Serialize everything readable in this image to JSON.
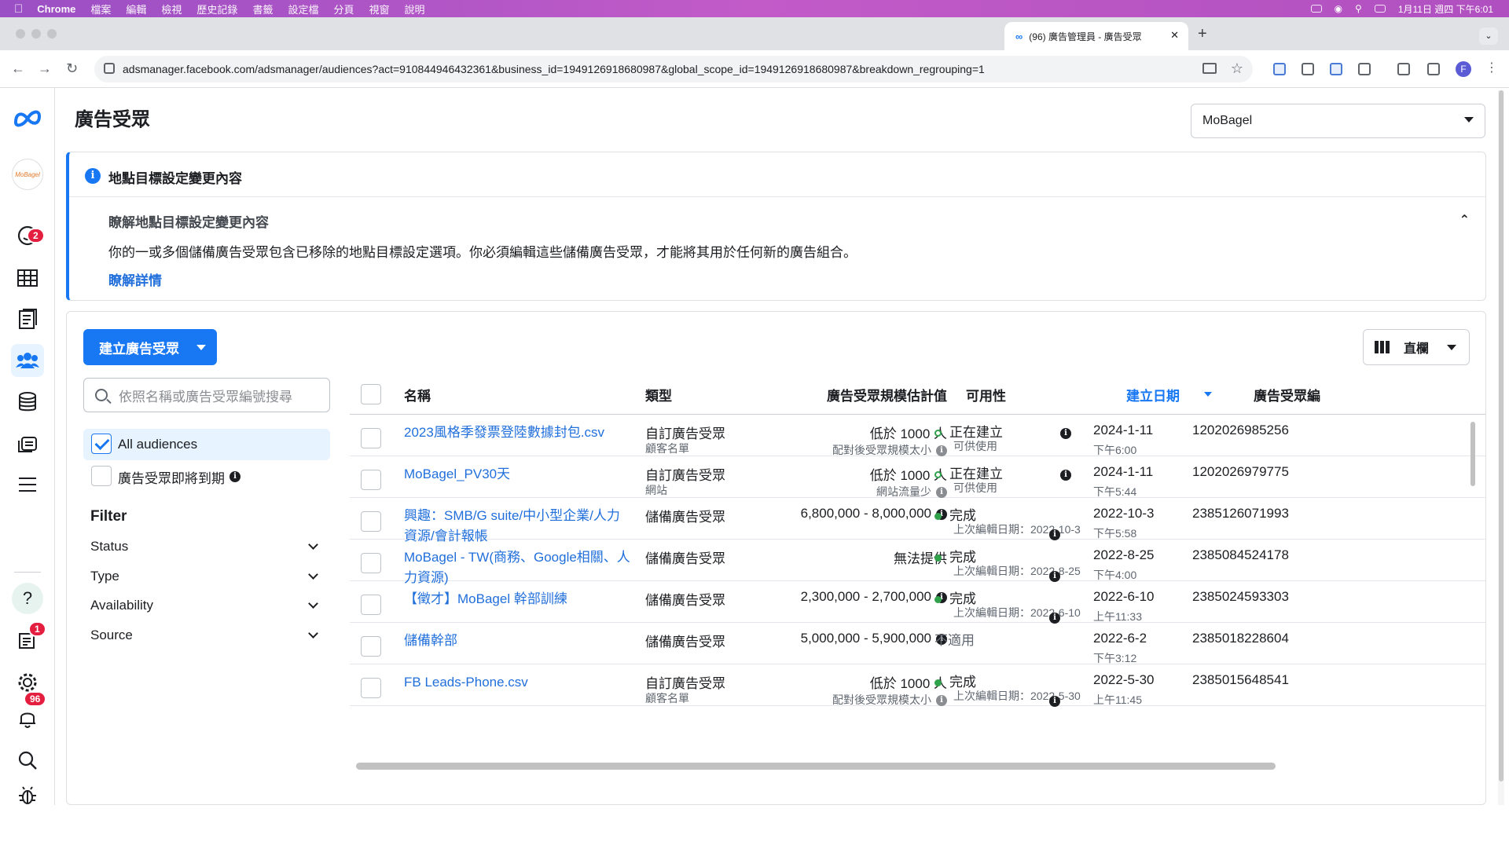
{
  "menubar": {
    "app": "Chrome",
    "items": [
      "檔案",
      "編輯",
      "檢視",
      "歷史記錄",
      "書籤",
      "設定檔",
      "分頁",
      "視窗",
      "說明"
    ],
    "clock": "1月11日 週四 下午6:01"
  },
  "browser": {
    "tab_title": "(96) 廣告管理員 - 廣告受眾",
    "new_tab": "+",
    "url": "adsmanager.facebook.com/adsmanager/audiences?act=910844946432361&business_id=1949126918680987&global_scope_id=1949126918680987&breakdown_regrouping=1",
    "profile": "F"
  },
  "rail": {
    "notifications_badge": "2",
    "alerts_badge": "1",
    "bell_badge": "96",
    "account_logo": "MoBagel"
  },
  "header": {
    "title": "廣告受眾",
    "account": "MoBagel"
  },
  "notice": {
    "title": "地點目標設定變更內容",
    "subtitle": "瞭解地點目標設定變更內容",
    "body": "你的一或多個儲備廣告受眾包含已移除的地點目標設定選項。你必須編輯這些儲備廣告受眾，才能將其用於任何新的廣告組合。",
    "link": "瞭解詳情"
  },
  "toolbar": {
    "create_label": "建立廣告受眾",
    "columns_label": "直欄",
    "search_placeholder": "依照名稱或廣告受眾編號搜尋"
  },
  "filters": {
    "all": "All audiences",
    "expiring": "廣告受眾即將到期",
    "heading": "Filter",
    "items": [
      "Status",
      "Type",
      "Availability",
      "Source"
    ]
  },
  "table": {
    "columns": [
      "名稱",
      "類型",
      "廣告受眾規模估計值",
      "可用性",
      "建立日期",
      "廣告受眾編"
    ],
    "rows": [
      {
        "name": "2023風格季發票登陸數據封包.csv",
        "type": "自訂廣告受眾",
        "type_sub": "顧客名單",
        "size": "低於 1000 人",
        "size_sub": "配對後受眾規模太小",
        "avail": "正在建立",
        "avail_sub": "可供使用",
        "date": "2024-1-11",
        "time": "下午6:00",
        "id": "1202026985256"
      },
      {
        "name": "MoBagel_PV30天",
        "type": "自訂廣告受眾",
        "type_sub": "網站",
        "size": "低於 1000 人",
        "size_sub": "網站流量少",
        "avail": "正在建立",
        "avail_sub": "可供使用",
        "date": "2024-1-11",
        "time": "下午5:44",
        "id": "1202026979775"
      },
      {
        "name": "興趣：SMB/G suite/中小型企業/人力資源/會計報帳",
        "type": "儲備廣告受眾",
        "type_sub": "",
        "size": "6,800,000 - 8,000,000",
        "size_sub": "",
        "avail": "完成",
        "avail_sub": "上次編輯日期：2022-10-3",
        "date": "2022-10-3",
        "time": "下午5:58",
        "id": "2385126071993"
      },
      {
        "name": "MoBagel - TW(商務、Google相關、人力資源)",
        "type": "儲備廣告受眾",
        "type_sub": "",
        "size": "無法提供",
        "size_sub": "",
        "avail": "完成",
        "avail_sub": "上次編輯日期：2022-8-25",
        "date": "2022-8-25",
        "time": "下午4:00",
        "id": "2385084524178"
      },
      {
        "name": "【徵才】MoBagel 幹部訓練",
        "type": "儲備廣告受眾",
        "type_sub": "",
        "size": "2,300,000 - 2,700,000",
        "size_sub": "",
        "avail": "完成",
        "avail_sub": "上次編輯日期：2022-6-10",
        "date": "2022-6-10",
        "time": "上午11:33",
        "id": "2385024593303"
      },
      {
        "name": "儲備幹部",
        "type": "儲備廣告受眾",
        "type_sub": "",
        "size": "5,000,000 - 5,900,000",
        "size_sub": "",
        "avail": "不適用",
        "avail_sub": "",
        "date": "2022-6-2",
        "time": "下午3:12",
        "id": "2385018228604"
      },
      {
        "name": "FB Leads-Phone.csv",
        "type": "自訂廣告受眾",
        "type_sub": "顧客名單",
        "size": "低於 1000 人",
        "size_sub": "配對後受眾規模太小",
        "avail": "完成",
        "avail_sub": "上次編輯日期：2022-5-30",
        "date": "2022-5-30",
        "time": "上午11:45",
        "id": "2385015648541"
      }
    ]
  },
  "colors": {
    "accent": "#1877f2",
    "link": "#216fdb",
    "success": "#31a24c",
    "badge": "#e41e3f"
  }
}
